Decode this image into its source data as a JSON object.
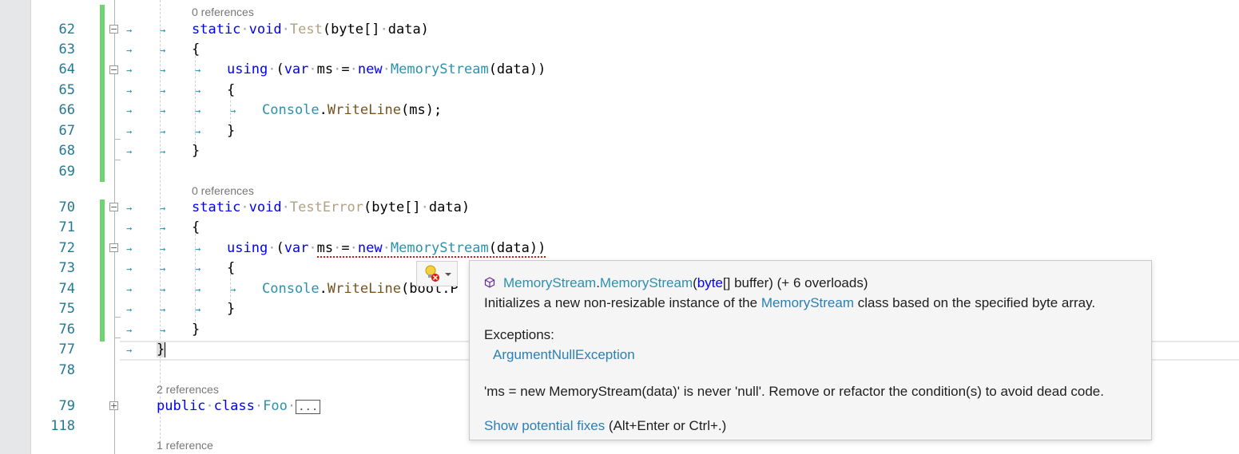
{
  "editor": {
    "lines": [
      {
        "num": "62"
      },
      {
        "num": "63"
      },
      {
        "num": "64"
      },
      {
        "num": "65"
      },
      {
        "num": "66"
      },
      {
        "num": "67"
      },
      {
        "num": "68"
      },
      {
        "num": "69"
      },
      {
        "num": "70"
      },
      {
        "num": "71"
      },
      {
        "num": "72"
      },
      {
        "num": "73"
      },
      {
        "num": "74"
      },
      {
        "num": "75"
      },
      {
        "num": "76"
      },
      {
        "num": "77"
      },
      {
        "num": "78"
      },
      {
        "num": "79"
      },
      {
        "num": "118"
      }
    ],
    "refs": {
      "test": "0 references",
      "test_error": "0 references",
      "foo": "2 references",
      "next": "1 reference"
    },
    "code": {
      "static": "static",
      "void": "void",
      "method_test": "Test",
      "method_test_error": "TestError",
      "params": "(byte[]",
      "param_name": "data)",
      "open_brace": "{",
      "close_brace": "}",
      "using": "using",
      "paren_open": "(",
      "var": "var",
      "ms": "ms",
      "eq": "=",
      "new": "new",
      "memory_stream": "MemoryStream",
      "ctor_args": "(data))",
      "console": "Console",
      "writeline": "WriteLine",
      "writeline_args": "(ms);",
      "writeline_partial": "(bool.P",
      "public": "public",
      "class": "class",
      "foo": "Foo",
      "collapsed": "..."
    }
  },
  "tooltip": {
    "signature_class": "MemoryStream",
    "signature_dot": ".",
    "signature_ctor": "MemoryStream",
    "signature_paren": "(",
    "signature_param_type": "byte",
    "signature_param_rest": "[] buffer)",
    "signature_overloads": " (+ 6 overloads)",
    "desc_before": "Initializes a new non-resizable instance of the ",
    "desc_link": "MemoryStream",
    "desc_after": " class based on the specified byte array.",
    "exceptions_label": "Exceptions:",
    "exception": "ArgumentNullException",
    "warning": "'ms = new MemoryStream(data)' is never 'null'. Remove or refactor the condition(s) to avoid dead code.",
    "fix_link": "Show potential fixes",
    "fix_shortcut": " (Alt+Enter or Ctrl+.)"
  },
  "colors": {
    "keyword": "#0000ff",
    "type": "#2b91af",
    "method": "#74531f",
    "line_number": "#237893",
    "change_bar": "#6fd36f",
    "error_squiggle": "#e51400"
  }
}
